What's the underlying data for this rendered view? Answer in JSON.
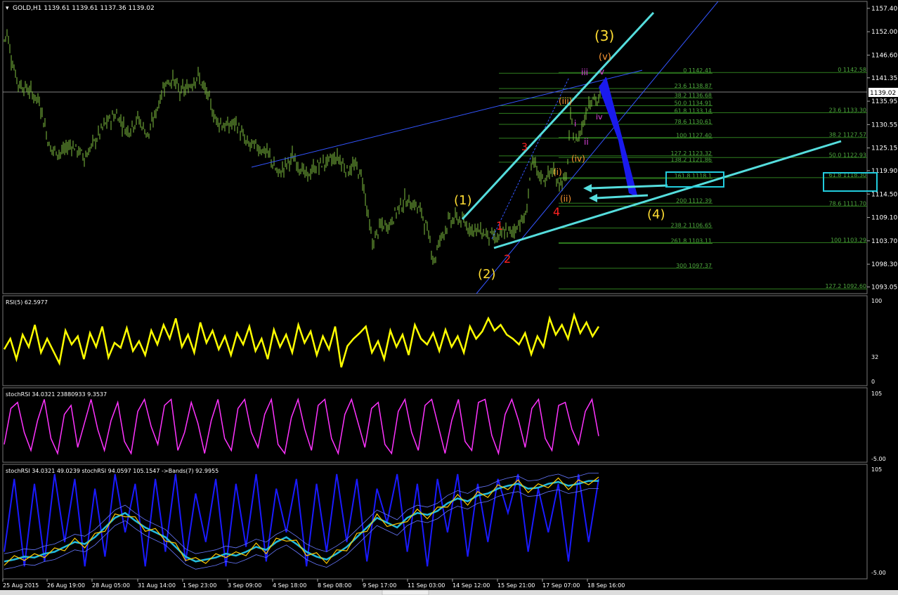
{
  "symbol_header": "GOLD,H1  1139.61 1139.61 1137.36 1139.02",
  "last_price_label": "1139.02",
  "colors": {
    "background": "#000000",
    "candles": "#7fbf3f",
    "rsi": "#ffff00",
    "stoch": "#ff33ff",
    "stoch_blue": "#1a1aff",
    "stoch_cyan": "#22bbdd",
    "stoch_gold": "#ffcc00",
    "trend_cyan": "#55dddd",
    "wave_yellow": "#ffdd33",
    "wave_red": "#ff2222",
    "wave_orange": "#ff9933",
    "wave_magenta": "#dd44dd",
    "fib_green": "#2f7f1f",
    "fib_text": "#4fa83f",
    "projection_blue": "#1a1aee"
  },
  "chart_data": [
    {
      "type": "candlestick",
      "panel": "main",
      "price_axis_labels": [
        "1157.40",
        "1152.00",
        "1146.60",
        "1141.35",
        "1135.95",
        "1130.55",
        "1125.15",
        "1119.90",
        "1114.50",
        "1109.10",
        "1103.70",
        "1098.30",
        "1093.05"
      ],
      "ylim": [
        1091.5,
        1159.0
      ],
      "time_labels": [
        "25 Aug 2015",
        "26 Aug 19:00",
        "28 Aug 05:00",
        "31 Aug 14:00",
        "1 Sep 23:00",
        "3 Sep 09:00",
        "4 Sep 18:00",
        "8 Sep 08:00",
        "9 Sep 17:00",
        "11 Sep 03:00",
        "14 Sep 12:00",
        "15 Sep 21:00",
        "17 Sep 07:00",
        "18 Sep 16:00"
      ],
      "close_path": [
        [
          0,
          1150.0
        ],
        [
          4,
          1152.0
        ],
        [
          10,
          1146.0
        ],
        [
          20,
          1140.0
        ],
        [
          35,
          1138.5
        ],
        [
          50,
          1136.0
        ],
        [
          65,
          1125.0
        ],
        [
          80,
          1124.0
        ],
        [
          95,
          1126.0
        ],
        [
          115,
          1123.0
        ],
        [
          130,
          1127.0
        ],
        [
          145,
          1131.0
        ],
        [
          160,
          1133.0
        ],
        [
          175,
          1129.0
        ],
        [
          190,
          1132.0
        ],
        [
          205,
          1128.0
        ],
        [
          215,
          1133.0
        ],
        [
          228,
          1140.0
        ],
        [
          240,
          1141.0
        ],
        [
          250,
          1138.0
        ],
        [
          262,
          1139.0
        ],
        [
          275,
          1142.0
        ],
        [
          290,
          1137.0
        ],
        [
          300,
          1132.0
        ],
        [
          315,
          1130.0
        ],
        [
          330,
          1131.0
        ],
        [
          345,
          1126.0
        ],
        [
          360,
          1125.5
        ],
        [
          375,
          1124.0
        ],
        [
          390,
          1119.0
        ],
        [
          400,
          1121.0
        ],
        [
          410,
          1123.0
        ],
        [
          420,
          1121.0
        ],
        [
          430,
          1118.5
        ],
        [
          445,
          1121.0
        ],
        [
          460,
          1122.0
        ],
        [
          475,
          1123.0
        ],
        [
          488,
          1120.0
        ],
        [
          500,
          1121.0
        ],
        [
          510,
          1118.0
        ],
        [
          518,
          1109.0
        ],
        [
          524,
          1103.0
        ],
        [
          535,
          1107.0
        ],
        [
          548,
          1107.5
        ],
        [
          560,
          1111.0
        ],
        [
          570,
          1113.0
        ],
        [
          585,
          1112.0
        ],
        [
          595,
          1110.0
        ],
        [
          605,
          1104.0
        ],
        [
          612,
          1099.0
        ],
        [
          620,
          1104.0
        ],
        [
          632,
          1108.0
        ],
        [
          645,
          1109.0
        ],
        [
          660,
          1107.0
        ],
        [
          675,
          1106.0
        ],
        [
          690,
          1105.0
        ],
        [
          703,
          1104.0
        ],
        [
          712,
          1106.0
        ],
        [
          722,
          1105.5
        ],
        [
          733,
          1108.0
        ],
        [
          742,
          1109.0
        ],
        [
          748,
          1118.0
        ],
        [
          752,
          1122.0
        ],
        [
          760,
          1119.0
        ],
        [
          770,
          1118.0
        ],
        [
          780,
          1120.0
        ],
        [
          790,
          1117.0
        ],
        [
          800,
          1118.0
        ],
        [
          806,
          1132.0
        ],
        [
          813,
          1126.0
        ],
        [
          820,
          1129.0
        ],
        [
          826,
          1132.0
        ],
        [
          832,
          1136.0
        ],
        [
          838,
          1137.0
        ],
        [
          845,
          1135.5
        ],
        [
          851,
          1139.0
        ]
      ]
    },
    {
      "type": "line",
      "panel": "RSI",
      "label": "RSI(5) 62.5977",
      "axis_labels": [
        "100",
        "32",
        "0"
      ],
      "ylim": [
        0,
        100
      ],
      "series": [
        {
          "name": "RSI(5)",
          "values": [
            42,
            55,
            30,
            60,
            45,
            72,
            38,
            55,
            40,
            25,
            65,
            48,
            58,
            30,
            62,
            45,
            70,
            32,
            50,
            44,
            68,
            40,
            52,
            35,
            65,
            48,
            72,
            55,
            80,
            45,
            60,
            38,
            75,
            50,
            65,
            42,
            58,
            35,
            62,
            48,
            70,
            40,
            55,
            30,
            66,
            45,
            60,
            38,
            72,
            50,
            64,
            35,
            58,
            42,
            70,
            20,
            46,
            55,
            62,
            70,
            38,
            52,
            30,
            65,
            45,
            60,
            35,
            72,
            55,
            48,
            62,
            40,
            66,
            45,
            58,
            38,
            70,
            55,
            64,
            80,
            65,
            72,
            60,
            55,
            48,
            62,
            36,
            58,
            45,
            80,
            60,
            72,
            55,
            84,
            62,
            75,
            58,
            70
          ]
        }
      ]
    },
    {
      "type": "line",
      "panel": "stochRSI",
      "label": "stochRSI 34.0321 23880933 9.3537",
      "axis_labels": [
        "105",
        "-5.00"
      ],
      "ylim": [
        -5,
        105
      ],
      "series": [
        {
          "name": "stochRSI",
          "values": [
            20,
            80,
            90,
            40,
            10,
            60,
            95,
            30,
            5,
            70,
            85,
            15,
            55,
            95,
            45,
            10,
            60,
            90,
            25,
            5,
            75,
            95,
            50,
            20,
            85,
            95,
            10,
            40,
            90,
            55,
            5,
            60,
            95,
            30,
            10,
            80,
            95,
            40,
            15,
            70,
            95,
            20,
            5,
            65,
            95,
            45,
            10,
            85,
            95,
            30,
            5,
            70,
            95,
            55,
            15,
            80,
            90,
            20,
            5,
            75,
            95,
            40,
            10,
            85,
            95,
            50,
            5,
            60,
            95,
            25,
            10,
            90,
            95,
            35,
            5,
            70,
            95,
            60,
            15,
            80,
            95,
            30,
            10,
            85,
            90,
            45,
            20,
            75,
            95,
            34
          ]
        }
      ]
    },
    {
      "type": "line",
      "panel": "stochRSI_bands",
      "label": "stochRSI 34.0321 49.0239  stochRSI 94.0597 105.1547  ->Bands(7) 92.9955",
      "axis_labels": [
        "105",
        "-5.00"
      ],
      "ylim": [
        -5,
        105
      ],
      "series": [
        {
          "name": "stochRSI",
          "values": [
            20,
            95,
            5,
            90,
            10,
            100,
            30,
            95,
            5,
            85,
            15,
            100,
            40,
            90,
            5,
            95,
            20,
            100,
            10,
            80,
            30,
            95,
            5,
            90,
            25,
            100,
            10,
            85,
            40,
            95,
            5,
            90,
            20,
            100,
            30,
            95,
            10,
            85,
            50,
            100,
            20,
            90,
            5,
            95,
            40,
            100,
            15,
            90,
            30,
            95,
            60,
            100,
            20,
            85,
            40,
            90,
            10,
            100,
            30,
            95
          ]
        },
        {
          "name": "Bands(7)",
          "values": [
            10,
            12,
            15,
            14,
            18,
            20,
            25,
            30,
            28,
            35,
            45,
            55,
            60,
            52,
            45,
            40,
            35,
            25,
            15,
            10,
            12,
            14,
            18,
            16,
            20,
            25,
            22,
            30,
            35,
            28,
            20,
            15,
            12,
            18,
            25,
            35,
            45,
            55,
            50,
            45,
            55,
            60,
            58,
            62,
            70,
            75,
            72,
            78,
            80,
            85,
            88,
            90,
            85,
            86,
            90,
            92,
            88,
            90,
            93,
            93
          ]
        }
      ]
    }
  ],
  "fib_levels_left": [
    {
      "label": "0 1142.41",
      "value": 1142.41
    },
    {
      "label": "23.6 1138.87",
      "value": 1138.87
    },
    {
      "label": "38.2 1136.68",
      "value": 1136.68
    },
    {
      "label": "50.0 1134.91",
      "value": 1134.91
    },
    {
      "label": "61.8 1133.14",
      "value": 1133.14
    },
    {
      "label": "78.6 1130.61",
      "value": 1130.61
    },
    {
      "label": "100 1127.40",
      "value": 1127.4
    },
    {
      "label": "127.2 1123.32",
      "value": 1123.32
    },
    {
      "label": "138.2 1121.86",
      "value": 1121.86
    },
    {
      "label": "161.8 1118.1",
      "value": 1118.1
    },
    {
      "label": "200 1112.39",
      "value": 1112.39
    },
    {
      "label": "238.2 1106.65",
      "value": 1106.65
    },
    {
      "label": "261.8 1103.11",
      "value": 1103.11
    },
    {
      "label": "300 1097.37",
      "value": 1097.37
    }
  ],
  "fib_levels_right": [
    {
      "label": "0 1142.58",
      "value": 1142.58
    },
    {
      "label": "23.6 1133.30",
      "value": 1133.3
    },
    {
      "label": "38.2 1127.57",
      "value": 1127.57
    },
    {
      "label": "50.0 1122.93",
      "value": 1122.93
    },
    {
      "label": "61.8 1118.30",
      "value": 1118.3
    },
    {
      "label": "78.6 1111.70",
      "value": 1111.7
    },
    {
      "label": "100 1103.29",
      "value": 1103.29
    },
    {
      "label": "127.2 1092.60",
      "value": 1092.6
    }
  ],
  "wave_labels": [
    {
      "text": "(3)",
      "color": "wave_yellow",
      "size": 20
    },
    {
      "text": "(1)",
      "color": "wave_yellow",
      "size": 18
    },
    {
      "text": "(2)",
      "color": "wave_yellow",
      "size": 18
    },
    {
      "text": "(4)",
      "color": "wave_yellow",
      "size": 18
    },
    {
      "text": "1",
      "color": "wave_red",
      "size": 16
    },
    {
      "text": "2",
      "color": "wave_red",
      "size": 16
    },
    {
      "text": "3",
      "color": "wave_red",
      "size": 14
    },
    {
      "text": "4",
      "color": "wave_red",
      "size": 16
    },
    {
      "text": "(v)",
      "color": "wave_orange",
      "size": 13
    },
    {
      "text": "(iii)",
      "color": "wave_orange",
      "size": 12
    },
    {
      "text": "(iv)",
      "color": "wave_orange",
      "size": 12
    },
    {
      "text": "(i)",
      "color": "wave_orange",
      "size": 12
    },
    {
      "text": "(ii)",
      "color": "wave_orange",
      "size": 12
    },
    {
      "text": "iii",
      "color": "wave_magenta",
      "size": 12
    },
    {
      "text": "v",
      "color": "wave_magenta",
      "size": 12
    },
    {
      "text": "ii",
      "color": "wave_magenta",
      "size": 12
    },
    {
      "text": "iv",
      "color": "wave_magenta",
      "size": 11
    },
    {
      "text": "i",
      "color": "wave_magenta",
      "size": 12
    }
  ]
}
